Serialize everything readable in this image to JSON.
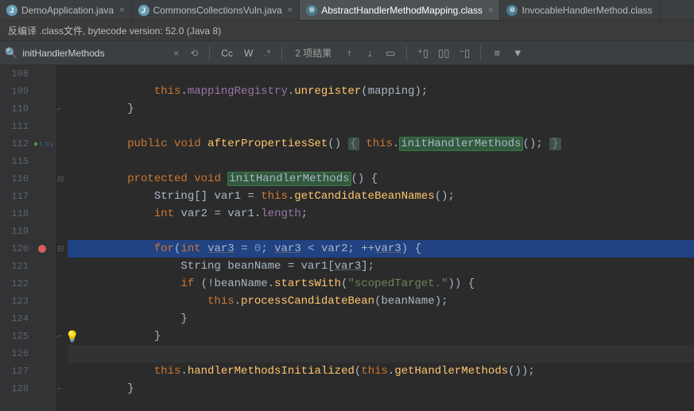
{
  "tabs": [
    {
      "label": "DemoApplication.java",
      "type": "java",
      "active": false
    },
    {
      "label": "CommonsCollectionsVuln.java",
      "type": "java",
      "active": false
    },
    {
      "label": "AbstractHandlerMethodMapping.class",
      "type": "class",
      "active": true
    },
    {
      "label": "InvocableHandlerMethod.class",
      "type": "class",
      "active": false
    }
  ],
  "info_bar": "反编译 .class文件, bytecode version: 52.0 (Java 8)",
  "find": {
    "query": "initHandlerMethods",
    "results_label": "2 项结果",
    "cc": "Cc",
    "ww": "W",
    "regex": ".*"
  },
  "line_numbers": [
    "108",
    "109",
    "110",
    "111",
    "112",
    "115",
    "116",
    "117",
    "118",
    "119",
    "120",
    "121",
    "122",
    "123",
    "124",
    "125",
    "126",
    "127",
    "128"
  ],
  "code": {
    "l109": {
      "a": "this",
      "b": ".",
      "c": "mappingRegistry",
      "d": ".",
      "e": "unregister",
      "f": "(mapping);"
    },
    "l110": "}",
    "l112": {
      "a": "public",
      "b": "void",
      "c": "afterPropertiesSet",
      "d": "() ",
      "e": "{",
      "f": "this",
      "g": ".",
      "h": "initHandlerMethods",
      "i": "();",
      "j": "}"
    },
    "l116": {
      "a": "protected",
      "b": "void",
      "c": "initHandlerMethods",
      "d": "() {"
    },
    "l117": {
      "a": "String[] var1 = ",
      "b": "this",
      "c": ".",
      "d": "getCandidateBeanNames",
      "e": "();"
    },
    "l118": {
      "a": "int",
      "b": " var2 = var1.",
      "c": "length",
      "d": ";"
    },
    "l120": {
      "a": "for",
      "b": "(",
      "c": "int",
      "d": " ",
      "e": "var3",
      "f": " = ",
      "g": "0",
      "h": "; ",
      "i": "var3",
      "j": " < var2; ++",
      "k": "var3",
      "l": ") {"
    },
    "l121": {
      "a": "String beanName = var1[",
      "b": "var3",
      "c": "];"
    },
    "l122": {
      "a": "if",
      "b": " (!beanName.",
      "c": "startsWith",
      "d": "(",
      "e": "\"scopedTarget.\"",
      "f": ")) {"
    },
    "l123": {
      "a": "this",
      "b": ".",
      "c": "processCandidateBean",
      "d": "(beanName);"
    },
    "l124": "}",
    "l125": "}",
    "l127": {
      "a": "this",
      "b": ".",
      "c": "handlerMethodsInitialized",
      "d": "(",
      "e": "this",
      "f": ".",
      "g": "getHandlerMethods",
      "h": "());"
    },
    "l128": "}"
  }
}
